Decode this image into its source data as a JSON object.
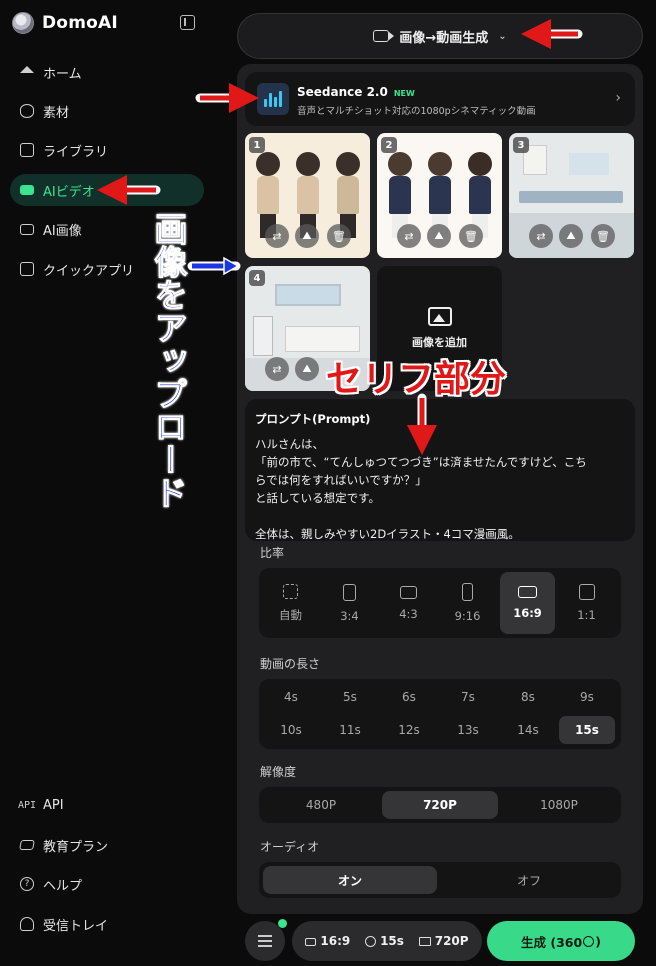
{
  "app": {
    "name": "DomoAI"
  },
  "sidebar": {
    "items": [
      {
        "label": "ホーム",
        "icon": "home-icon"
      },
      {
        "label": "素材",
        "icon": "assets-icon"
      },
      {
        "label": "ライブラリ",
        "icon": "library-icon"
      },
      {
        "label": "AIビデオ",
        "icon": "video-icon",
        "active": true
      },
      {
        "label": "AI画像",
        "icon": "image-icon"
      },
      {
        "label": "クイックアプリ",
        "icon": "quick-app-icon"
      }
    ],
    "bottom_items": [
      {
        "label": "API",
        "icon": "api-icon",
        "icon_text": "API"
      },
      {
        "label": "教育プラン",
        "icon": "education-icon"
      },
      {
        "label": "ヘルプ",
        "icon": "help-icon",
        "icon_text": "?"
      },
      {
        "label": "受信トレイ",
        "icon": "bell-icon"
      }
    ]
  },
  "mode": {
    "label": "画像→動画生成",
    "chevron": "⌄"
  },
  "model": {
    "name": "Seedance 2.0",
    "badge": "NEW",
    "description": "音声とマルチショット対応の1080pシネマティック動画",
    "chevron": "›"
  },
  "images": [
    {
      "num": "1",
      "kind": "characters"
    },
    {
      "num": "2",
      "kind": "characters"
    },
    {
      "num": "3",
      "kind": "room"
    },
    {
      "num": "4",
      "kind": "room"
    }
  ],
  "image_buttons": {
    "swap": "⇄",
    "enhance": "⛰",
    "delete": "🗑"
  },
  "add_image": {
    "label": "画像を追加"
  },
  "prompt": {
    "title": "プロンプト(Prompt)",
    "lines": [
      "ハルさんは、",
      "「前の市で、“てんしゅつてつづき”は済ませたんですけど、こち",
      "らでは何をすればいいですか？」",
      "と話している想定です。",
      "",
      "全体は、親しみやすい2Dイラスト・4コマ漫画風。"
    ]
  },
  "aspect": {
    "label": "比率",
    "options": [
      "自動",
      "3:4",
      "4:3",
      "9:16",
      "16:9",
      "1:1"
    ],
    "selected": "16:9"
  },
  "duration": {
    "label": "動画の長さ",
    "options": [
      "4s",
      "5s",
      "6s",
      "7s",
      "8s",
      "9s",
      "10s",
      "11s",
      "12s",
      "13s",
      "14s",
      "15s"
    ],
    "selected": "15s"
  },
  "resolution": {
    "label": "解像度",
    "options": [
      "480P",
      "720P",
      "1080P"
    ],
    "selected": "720P"
  },
  "audio": {
    "label": "オーディオ",
    "options": [
      "オン",
      "オフ"
    ],
    "selected": "オン"
  },
  "summary": {
    "ratio": "16:9",
    "duration": "15s",
    "resolution": "720P"
  },
  "generate": {
    "label": "生成 (360",
    "credit_icon": "credit-icon",
    "suffix": ")"
  },
  "annotations": {
    "upload_text": "画像をアップロード",
    "dialogue_text": "セリフ部分",
    "colors": {
      "red": "#e01818",
      "blue": "#1c36e6",
      "accent": "#39e58f"
    }
  }
}
